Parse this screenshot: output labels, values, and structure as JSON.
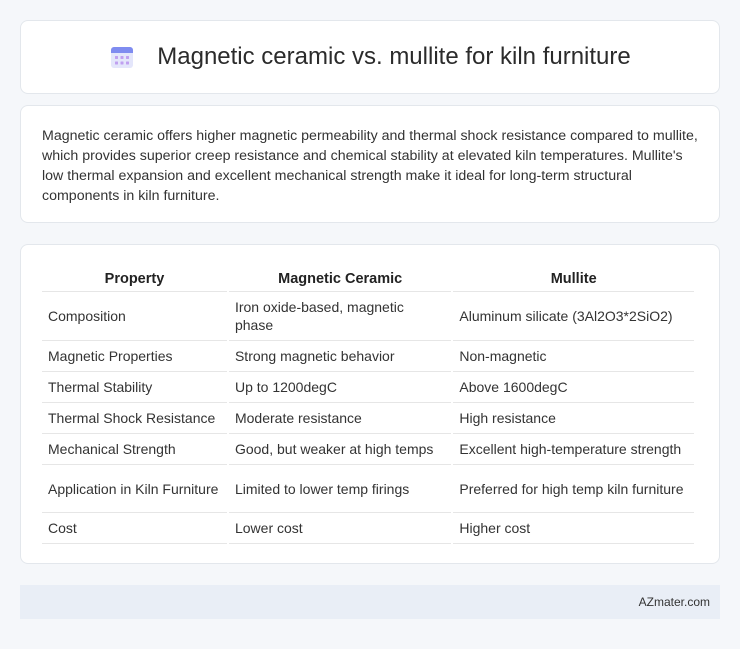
{
  "header": {
    "title": "Magnetic ceramic vs. mullite for kiln furniture",
    "icon": "calendar-icon"
  },
  "summary": {
    "text": "Magnetic ceramic offers higher magnetic permeability and thermal shock resistance compared to mullite, which provides superior creep resistance and chemical stability at elevated kiln temperatures. Mullite's low thermal expansion and excellent mechanical strength make it ideal for long-term structural components in kiln furniture."
  },
  "table": {
    "headers": [
      "Property",
      "Magnetic Ceramic",
      "Mullite"
    ],
    "rows": [
      [
        "Composition",
        "Iron oxide-based, magnetic phase",
        "Aluminum silicate (3Al2O3*2SiO2)"
      ],
      [
        "Magnetic Properties",
        "Strong magnetic behavior",
        "Non-magnetic"
      ],
      [
        "Thermal Stability",
        "Up to 1200degC",
        "Above 1600degC"
      ],
      [
        "Thermal Shock Resistance",
        "Moderate resistance",
        "High resistance"
      ],
      [
        "Mechanical Strength",
        "Good, but weaker at high temps",
        "Excellent high-temperature strength"
      ],
      [
        "Application in Kiln Furniture",
        "Limited to lower temp firings",
        "Preferred for high temp kiln furniture"
      ],
      [
        "Cost",
        "Lower cost",
        "Higher cost"
      ]
    ]
  },
  "footer": {
    "text": "AZmater.com"
  }
}
